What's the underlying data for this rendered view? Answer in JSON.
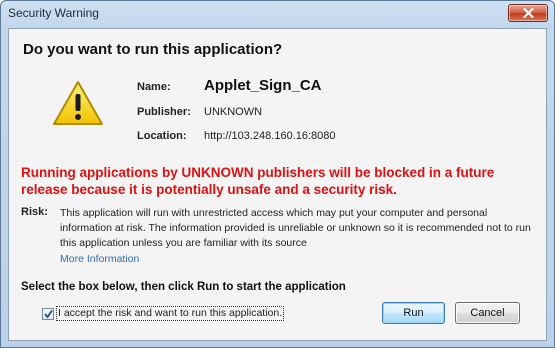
{
  "window": {
    "title": "Security Warning"
  },
  "dialog": {
    "heading": "Do you want to run this application?",
    "info": {
      "name_label": "Name:",
      "name_value": "Applet_Sign_CA",
      "publisher_label": "Publisher:",
      "publisher_value": "UNKNOWN",
      "location_label": "Location:",
      "location_value": "http://103.248.160.16:8080"
    },
    "red_warning": "Running applications by UNKNOWN publishers will be blocked in a future release because it is potentially unsafe and a security risk.",
    "risk_label": "Risk:",
    "risk_text": "This application will run with unrestricted access which may put your computer and personal information at risk. The information provided is unreliable or unknown so it is recommended not to run this application unless you are familiar with its source",
    "more_info": "More Information",
    "instruction": "Select the box below, then click Run to start the application",
    "accept_label": "I accept the risk and want to run this application.",
    "accept_checked": true,
    "run_label": "Run",
    "cancel_label": "Cancel"
  },
  "icons": {
    "warning": "warning-triangle-icon",
    "close": "close-icon",
    "check": "checkmark-icon"
  },
  "colors": {
    "warning_text": "#e01010",
    "link": "#2f6fb8",
    "close_button": "#c23a1e"
  }
}
